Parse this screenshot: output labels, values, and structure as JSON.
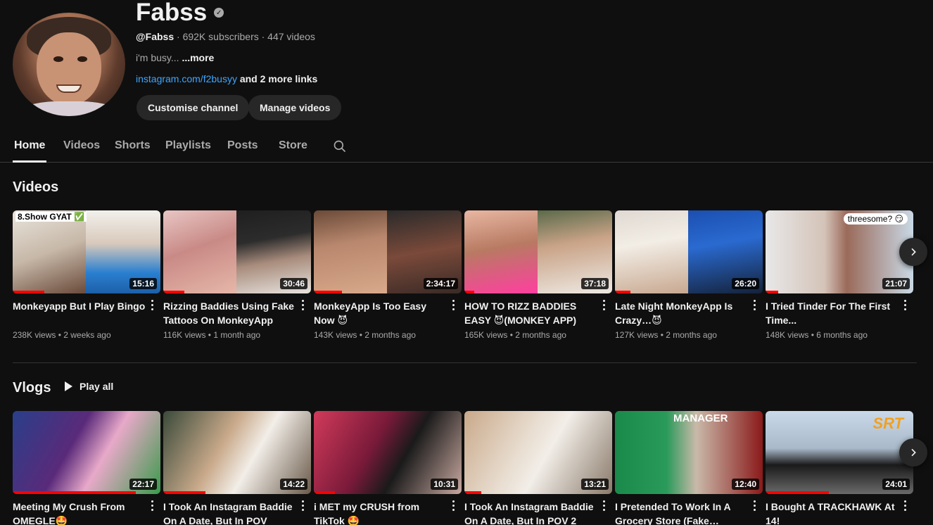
{
  "channel": {
    "name": "Fabss",
    "handle": "@Fabss",
    "stats": " · 692K subscribers · 447 videos",
    "desc": "i'm busy... ",
    "more": "...more",
    "link": "instagram.com/f2busyy",
    "more_links": " and 2 more links",
    "customise": "Customise channel",
    "manage": "Manage videos"
  },
  "tabs": [
    "Home",
    "Videos",
    "Shorts",
    "Playlists",
    "Posts",
    "Store"
  ],
  "sections": {
    "videos": "Videos",
    "vlogs": "Vlogs",
    "play_all": "Play all"
  },
  "videos": [
    {
      "title": "Monkeyapp But I Play Bingo",
      "meta": "238K views • 2 weeks ago",
      "dur": "15:16",
      "tag": "8.Show GYAT ✅"
    },
    {
      "title": "Rizzing Baddies Using Fake Tattoos On MonkeyApp",
      "meta": "116K views • 1 month ago",
      "dur": "30:46"
    },
    {
      "title": "MonkeyApp Is Too Easy Now 😈",
      "meta": "143K views • 2 months ago",
      "dur": "2:34:17"
    },
    {
      "title": "HOW TO RIZZ BADDIES EASY 😈(MONKEY APP)",
      "meta": "165K views • 2 months ago",
      "dur": "37:18"
    },
    {
      "title": "Late Night MonkeyApp Is Crazy…😈",
      "meta": "127K views • 2 months ago",
      "dur": "26:20"
    },
    {
      "title": "I Tried Tinder For The First Time...",
      "meta": "148K views • 6 months ago",
      "dur": "21:07",
      "tag2": "threesome? 😏"
    }
  ],
  "vlogs": [
    {
      "title": "Meeting My Crush From OMEGLE🤩",
      "dur": "22:17"
    },
    {
      "title": "I Took An Instagram Baddie On A Date, But In POV",
      "dur": "14:22"
    },
    {
      "title": "i MET my CRUSH from TikTok 🤩",
      "dur": "10:31"
    },
    {
      "title": "I Took An Instagram Baddie On A Date, But In POV 2",
      "dur": "13:21"
    },
    {
      "title": "I Pretended To Work In A Grocery Store (Fake…",
      "dur": "12:40",
      "tag": "MANAGER"
    },
    {
      "title": "I Bought A TRACKHAWK At 14!",
      "dur": "24:01",
      "tag2": "SRT"
    }
  ],
  "colors": {
    "bg": "#0f0f0f",
    "accent_link": "#3ea6ff",
    "progress": "#ff0000"
  }
}
